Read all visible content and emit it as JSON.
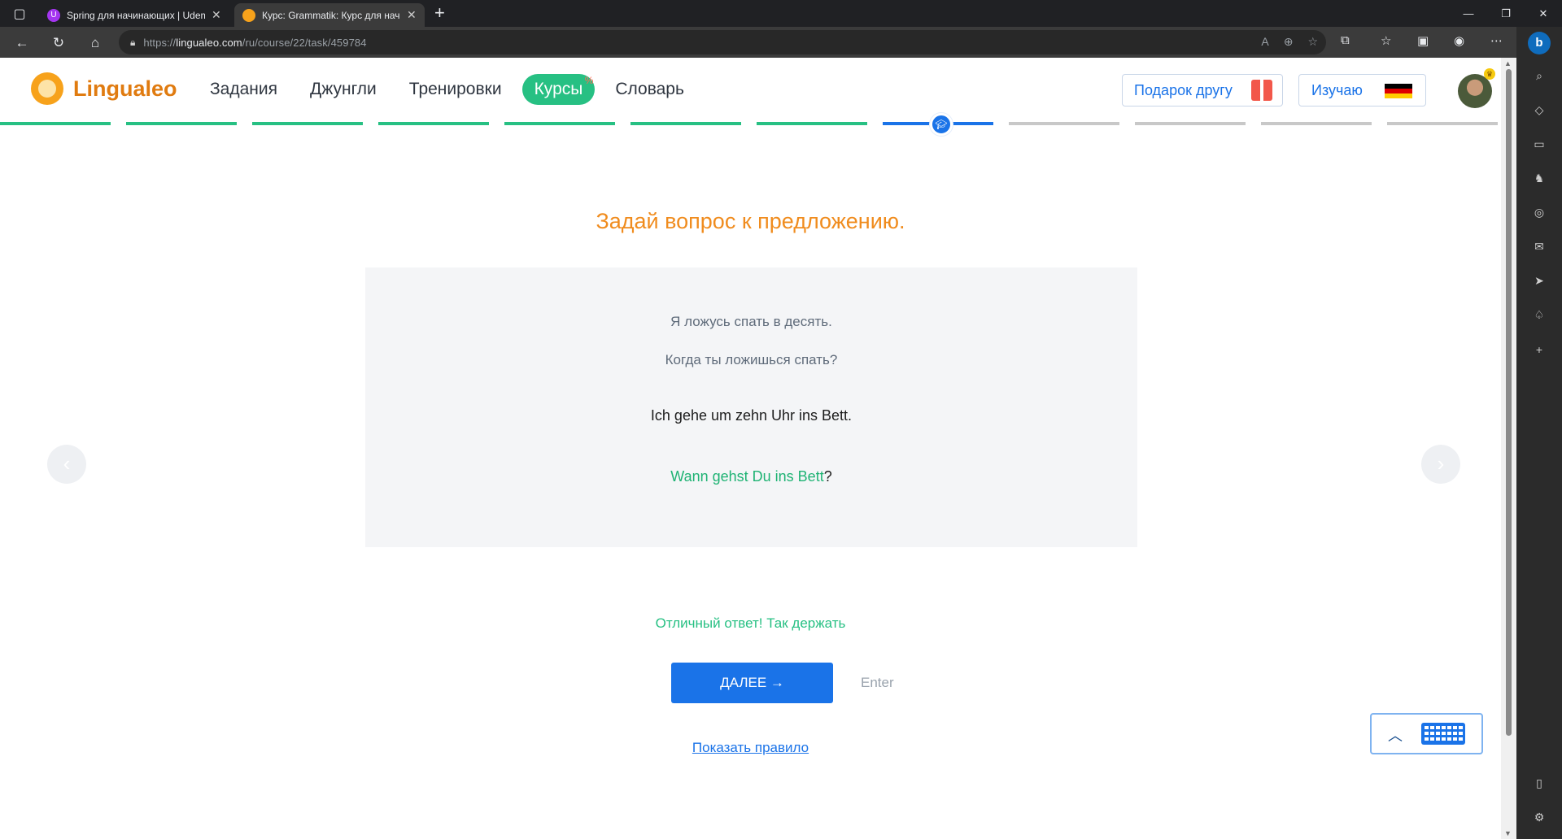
{
  "browser": {
    "tabs": [
      {
        "title": "Spring для начинающих | Udem",
        "active": false,
        "favicon_color": "#a435f0"
      },
      {
        "title": "Курс: Grammatik: Курс для начи",
        "active": true,
        "favicon_color": "#f7a21b"
      }
    ],
    "url_prefix": "https://",
    "url_host": "lingualeo.com",
    "url_path": "/ru/course/22/task/459784"
  },
  "site": {
    "logo_text": "Lingualeo",
    "nav": [
      {
        "label": "Задания"
      },
      {
        "label": "Джунгли"
      },
      {
        "label": "Тренировки"
      },
      {
        "label": "Курсы",
        "active": true
      },
      {
        "label": "Словарь"
      }
    ],
    "gift_button": "Подарок другу",
    "learning_button": "Изучаю",
    "learning_flag": [
      "#000000",
      "#dd0000",
      "#ffce00"
    ]
  },
  "progress": {
    "segments": [
      "done",
      "done",
      "done",
      "done",
      "done",
      "done",
      "done",
      "current",
      "todo",
      "todo",
      "todo",
      "todo"
    ]
  },
  "task": {
    "title": "Задай вопрос к предложению.",
    "hint_ru": "Я ложусь спать в десять.",
    "hint_question_ru": "Когда ты ложишься спать?",
    "sentence": "Ich gehe um zehn Uhr ins Bett.",
    "answer_correct_part": "Wann gehst Du ins Bett",
    "answer_punct": "?",
    "feedback": "Отличный ответ! Так держать",
    "next_button": "ДАЛЕЕ →",
    "enter_hint": "Enter",
    "rule_link": "Показать правило"
  },
  "colors": {
    "accent_green": "#27c083",
    "accent_blue": "#1a73e8",
    "title_orange": "#f08c1e"
  }
}
